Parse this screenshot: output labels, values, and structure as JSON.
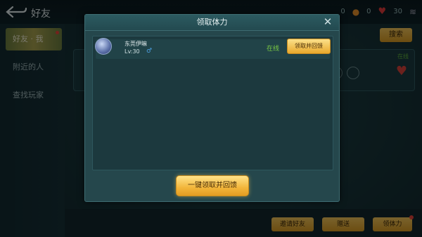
{
  "screen": {
    "title": "好友",
    "status": {
      "count_a": "0",
      "count_b": "0",
      "hearts": "30"
    }
  },
  "sidebar": {
    "items": [
      {
        "label": "好友 · 我"
      },
      {
        "label": "附近的人"
      },
      {
        "label": "查找玩家"
      }
    ]
  },
  "main": {
    "search_label": "搜索",
    "card_status": "在线"
  },
  "bottom": {
    "buttons": [
      {
        "label": "邀请好友"
      },
      {
        "label": "赠送"
      },
      {
        "label": "领体力"
      }
    ]
  },
  "dialog": {
    "title": "领取体力",
    "friend": {
      "name": "东莞伊嘛",
      "level": "Lv:30",
      "status": "在线",
      "claim_label": "领取并回馈"
    },
    "claim_all_label": "一键领取并回馈"
  },
  "colors": {
    "accent_gold": "#f2b53a",
    "online_green": "#7ac943",
    "heart_red": "#e23a3a"
  },
  "icons": [
    "back-arrow-icon",
    "heart-icon",
    "close-icon",
    "gender-male-icon"
  ]
}
